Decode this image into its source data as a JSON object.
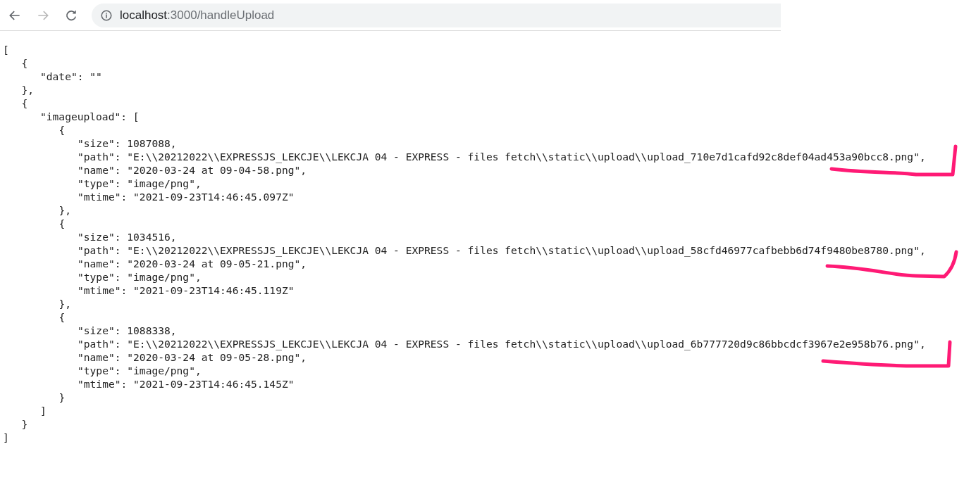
{
  "browser": {
    "back_disabled": false,
    "forward_disabled": true,
    "url_host": "localhost",
    "url_path": ":3000/handleUpload"
  },
  "document": {
    "lines": [
      {
        "text": "[",
        "children": [
          {
            "text": "{",
            "children": [
              {
                "text": "\"date\": \"\""
              }
            ]
          },
          {
            "text": "},"
          },
          {
            "text": "{",
            "children": [
              {
                "text": "\"imageupload\": [",
                "children": [
                  {
                    "text": "{",
                    "children": [
                      {
                        "text": "\"size\": 1087088,"
                      },
                      {
                        "text": "\"path\": \"E:\\\\20212022\\\\EXPRESSJS_LEKCJE\\\\LEKCJA 04 - EXPRESS - files fetch\\\\static\\\\upload\\\\upload_710e7d1cafd92c8def04ad453a90bcc8.png\","
                      },
                      {
                        "text": "\"name\": \"2020-03-24 at 09-04-58.png\","
                      },
                      {
                        "text": "\"type\": \"image/png\","
                      },
                      {
                        "text": "\"mtime\": \"2021-09-23T14:46:45.097Z\""
                      }
                    ]
                  },
                  {
                    "text": "},"
                  },
                  {
                    "text": "{",
                    "children": [
                      {
                        "text": "\"size\": 1034516,"
                      },
                      {
                        "text": "\"path\": \"E:\\\\20212022\\\\EXPRESSJS_LEKCJE\\\\LEKCJA 04 - EXPRESS - files fetch\\\\static\\\\upload\\\\upload_58cfd46977cafbebb6d74f9480be8780.png\","
                      },
                      {
                        "text": "\"name\": \"2020-03-24 at 09-05-21.png\","
                      },
                      {
                        "text": "\"type\": \"image/png\","
                      },
                      {
                        "text": "\"mtime\": \"2021-09-23T14:46:45.119Z\""
                      }
                    ]
                  },
                  {
                    "text": "},"
                  },
                  {
                    "text": "{",
                    "children": [
                      {
                        "text": "\"size\": 1088338,"
                      },
                      {
                        "text": "\"path\": \"E:\\\\20212022\\\\EXPRESSJS_LEKCJE\\\\LEKCJA 04 - EXPRESS - files fetch\\\\static\\\\upload\\\\upload_6b777720d9c86bbcdcf3967e2e958b76.png\","
                      },
                      {
                        "text": "\"name\": \"2020-03-24 at 09-05-28.png\","
                      },
                      {
                        "text": "\"type\": \"image/png\","
                      },
                      {
                        "text": "\"mtime\": \"2021-09-23T14:46:45.145Z\""
                      }
                    ]
                  },
                  {
                    "text": "}"
                  }
                ]
              },
              {
                "text": "]"
              }
            ]
          },
          {
            "text": "}"
          }
        ]
      },
      {
        "text": "]"
      }
    ]
  }
}
